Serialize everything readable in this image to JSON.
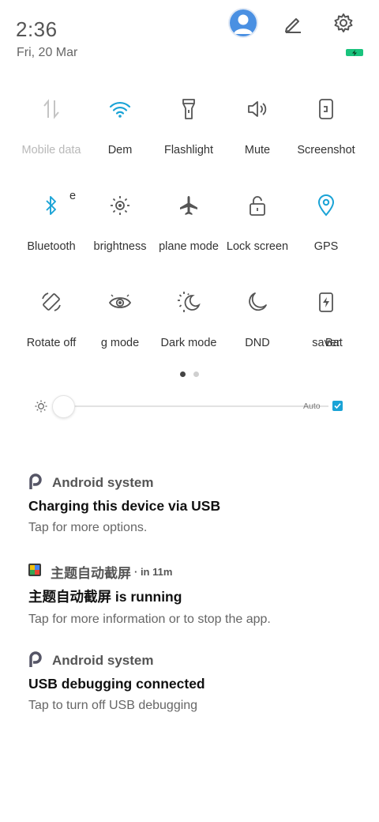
{
  "status": {
    "time": "2:36",
    "date": "Fri, 20 Mar"
  },
  "header_icons": [
    "user-avatar-icon",
    "pencil-icon",
    "gear-icon",
    "battery-charging-icon"
  ],
  "colors": {
    "accent": "#1aa3d6",
    "battery": "#19c37d",
    "icon_default": "#555555",
    "dim": "#c4c4c4"
  },
  "tiles": [
    {
      "label": "Mobile data",
      "icon": "mobile-data-icon",
      "state": "disabled"
    },
    {
      "label": "e",
      "icon": "",
      "state": "partial"
    },
    {
      "label": "Dem",
      "icon": "wifi-icon",
      "state": "active"
    },
    {
      "label": "Flashlight",
      "icon": "flashlight-icon",
      "state": "off"
    },
    {
      "label": "Mute",
      "icon": "speaker-icon",
      "state": "off"
    },
    {
      "label": "Screenshot",
      "icon": "screenshot-icon",
      "state": "off"
    },
    {
      "label": "Bluetooth",
      "icon": "bluetooth-icon",
      "state": "active"
    },
    {
      "label": "brightness",
      "icon": "brightness-icon",
      "state": "off"
    },
    {
      "label": "plane mode",
      "icon": "airplane-icon",
      "state": "off"
    },
    {
      "label": "Lock screen",
      "icon": "lock-icon",
      "state": "off"
    },
    {
      "label": "GPS",
      "icon": "location-pin-icon",
      "state": "active"
    },
    {
      "label": "Rotate off",
      "icon": "rotate-icon",
      "state": "off"
    },
    {
      "label": "g mode",
      "icon": "eye-icon",
      "state": "off"
    },
    {
      "label": "Dark mode",
      "icon": "dark-mode-icon",
      "state": "off"
    },
    {
      "label": "DND",
      "icon": "moon-icon",
      "state": "off"
    },
    {
      "label": "saver",
      "icon": "battery-saver-icon",
      "state": "off"
    },
    {
      "label": "Bat",
      "icon": "",
      "state": "partial"
    }
  ],
  "pager": {
    "pages": 2,
    "current": 1
  },
  "brightness": {
    "level": 0.0,
    "auto_label": "Auto",
    "auto_checked": true,
    "icon": "sun-small-icon"
  },
  "notifications": [
    {
      "app": "Android system",
      "time": "",
      "title": "Charging this device via USB",
      "text": "Tap for more options.",
      "icon": "android-p-icon"
    },
    {
      "app": "主题自动截屏",
      "time": "· in 11m",
      "title": "主题自动截屏 is running",
      "text": "Tap for more information or to stop the app.",
      "icon": "app-icon"
    },
    {
      "app": "Android system",
      "time": "",
      "title": "USB debugging connected",
      "text": "Tap to turn off USB debugging",
      "icon": "android-p-icon"
    }
  ]
}
